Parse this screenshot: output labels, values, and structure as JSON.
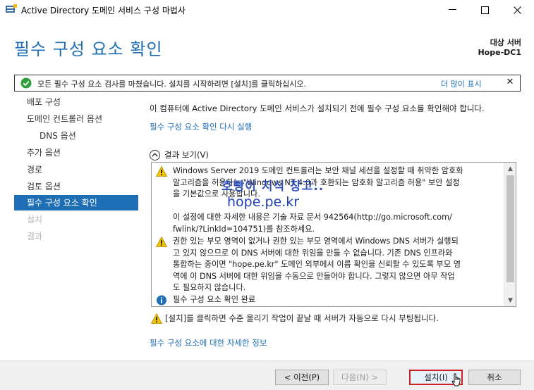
{
  "window": {
    "title": "Active Directory 도메인 서비스 구성 마법사"
  },
  "header": {
    "title": "필수 구성 요소 확인",
    "target_label": "대상 서버",
    "target_name": "Hope-DC1"
  },
  "notice": {
    "text": "모든 필수 구성 요소 검사를 마쳤습니다. 설치를 시작하려면 [설치]를 클릭하십시오.",
    "more": "더 많이 표시",
    "close": "✕"
  },
  "nav": {
    "items": [
      {
        "label": "배포 구성",
        "state": "normal"
      },
      {
        "label": "도메인 컨트롤러 옵션",
        "state": "normal"
      },
      {
        "label": "DNS 옵션",
        "state": "indent"
      },
      {
        "label": "추가 옵션",
        "state": "normal"
      },
      {
        "label": "경로",
        "state": "normal"
      },
      {
        "label": "검토 옵션",
        "state": "normal"
      },
      {
        "label": "필수 구성 요소 확인",
        "state": "active"
      },
      {
        "label": "설치",
        "state": "disabled"
      },
      {
        "label": "결과",
        "state": "disabled"
      }
    ]
  },
  "content": {
    "description": "이 컴퓨터에 Active Directory 도메인 서비스가 설치되기 전에 필수 구성 요소를 확인해야 합니다.",
    "rerun_link": "필수 구성 요소 확인 다시 실행",
    "results_toggle": "결과 보기(V)",
    "results": {
      "warning1_lines": [
        "Windows Server 2019 도메인 컨트롤러는 보안 채널 세션을 설정할 때 취약한 암호화",
        "알고리즘을 허용하는 \"Windows NT 4.0과 호환되는 암호화 알고리즘 허용\" 보안 설정",
        "을 기본값으로 사용합니다."
      ],
      "info1_lines": [
        "이 설정에 대한 자세한 내용은 기술 자료 문서 942564(http://go.microsoft.com/",
        "fwlink/?LinkId=104751)를 참조하세요."
      ],
      "warning2_lines": [
        "권한 있는 부모 영역이 없거나 권한 있는 부모 영역에서 Windows DNS 서버가 실행되",
        "고 있지 않으므로 이 DNS 서버에 대한 위임을 만들 수 없습니다. 기존 DNS 인프라와",
        "통합하는 중이면 \"hope.pe.kr\" 도메인 외부에서 이름 확인을 신뢰할 수 있도록 부모 영",
        "역에 이 DNS 서버에 대한 위임을 수동으로 만들어야 합니다. 그렇지 않으면 아무 작업",
        "도 필요하지 않습니다."
      ],
      "complete": "필수 구성 요소 확인 완료"
    },
    "reboot_note": "[설치]를 클릭하면 수준 올리기 작업이 끝날 때 서버가 자동으로 다시 부팅됩니다.",
    "more_link": "필수 구성 요소에 대한 자세한 정보"
  },
  "watermark": {
    "line1": "호빵이 지식 창고..",
    "line2": "hope.pe.kr"
  },
  "footer": {
    "prev": "< 이전(P)",
    "next": "다음(N) >",
    "install": "설치(I)",
    "cancel": "취소"
  },
  "colors": {
    "accent": "#1e6fb5",
    "warning": "#f2c200",
    "success": "#2e9e3e",
    "highlight_border": "#cc2222"
  }
}
